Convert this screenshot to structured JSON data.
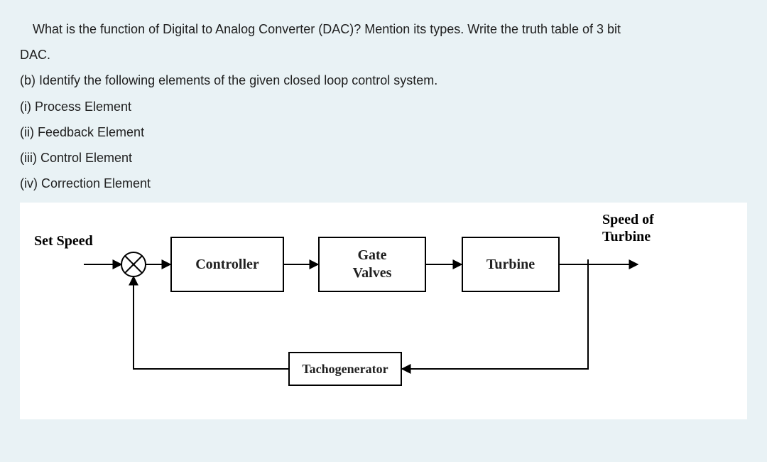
{
  "question": {
    "part_a_line1": "What is the function of Digital to Analog Converter (DAC)? Mention its types. Write the truth table of 3 bit",
    "part_a_line2": "DAC.",
    "part_b_intro": "(b) Identify the following elements of the given closed loop control system.",
    "items": [
      "(i) Process Element",
      "(ii) Feedback Element",
      "(iii) Control Element",
      "(iv) Correction Element"
    ]
  },
  "diagram": {
    "input_label": "Set Speed",
    "output_label_l1": "Speed of",
    "output_label_l2": "Turbine",
    "blocks": {
      "controller": "Controller",
      "gate_l1": "Gate",
      "gate_l2": "Valves",
      "turbine": "Turbine",
      "tacho": "Tachogenerator"
    }
  }
}
